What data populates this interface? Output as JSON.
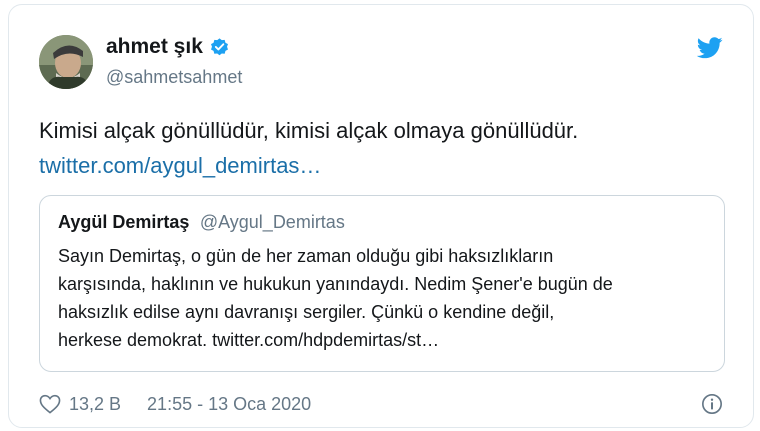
{
  "author": {
    "name": "ahmet şık",
    "handle": "@sahmetsahmet",
    "verified": true
  },
  "tweet": {
    "text": "Kimisi alçak gönüllüdür, kimisi alçak olmaya gönüllüdür.",
    "link": "twitter.com/aygul_demirtas…"
  },
  "quoted_tweet": {
    "name": "Aygül Demirtaş",
    "handle": "@Aygul_Demirtas",
    "lines": [
      "Sayın Demirtaş, o gün de her zaman olduğu gibi haksızlıkların",
      "karşısında, haklının ve hukukun yanındaydı. Nedim Şener'e bugün de",
      "haksızlık edilse aynı davranışı sergiler. Çünkü o kendine değil,",
      "herkese demokrat. twitter.com/hdpdemirtas/st…"
    ]
  },
  "footer": {
    "like_count": "13,2 B",
    "timestamp": "21:55 - 13 Oca 2020"
  },
  "icons": {
    "verified": "verified-badge-icon",
    "brand": "twitter-bird-icon",
    "like": "heart-icon",
    "info": "info-icon"
  },
  "colors": {
    "accent": "#1da1f2",
    "link": "#1b6fa8",
    "text": "#14171a",
    "muted": "#657786",
    "border": "#e1e8ed"
  }
}
